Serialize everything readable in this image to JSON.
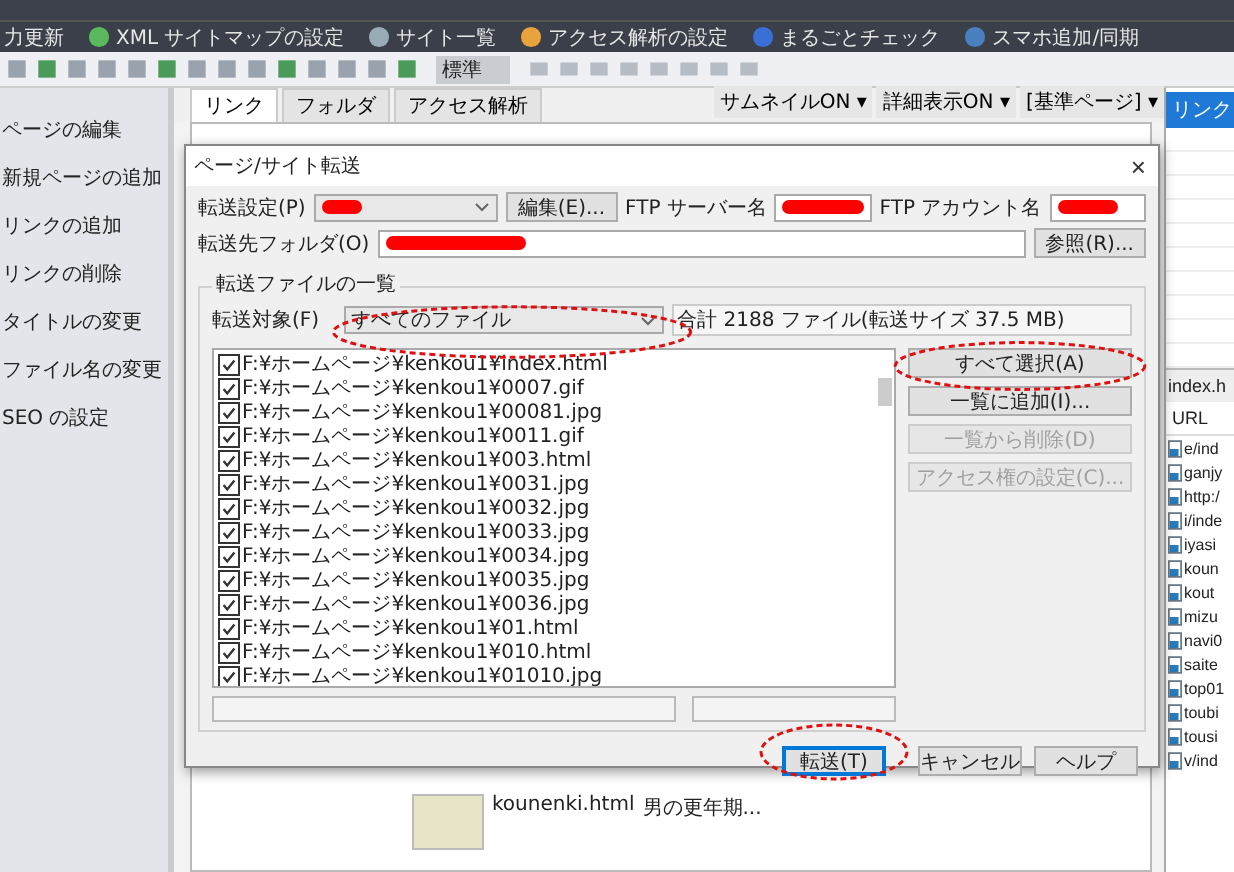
{
  "menu_bar": {
    "items": [
      {
        "label": "力更新"
      },
      {
        "label": "XML サイトマップの設定"
      },
      {
        "label": "サイト一覧"
      },
      {
        "label": "アクセス解析の設定"
      },
      {
        "label": "まるごとチェック"
      },
      {
        "label": "スマホ追加/同期"
      }
    ]
  },
  "toolbar": {
    "style_select": "標準"
  },
  "sidebar": {
    "items": [
      "ページの編集",
      "新規ページの追加",
      "リンクの追加",
      "リンクの削除",
      "タイトルの変更",
      "ファイル名の変更",
      "SEO の設定"
    ]
  },
  "center": {
    "tabs": [
      {
        "label": "リンク",
        "selected": true
      },
      {
        "label": "フォルダ",
        "selected": false
      },
      {
        "label": "アクセス解析",
        "selected": false
      }
    ],
    "view_options": [
      "サムネイルON ▾",
      "詳細表示ON ▾",
      "[基準ページ] ▾"
    ],
    "thumbnails": [
      {
        "file": "kounenki.html",
        "title": "男の更年期..."
      }
    ]
  },
  "right_panel": {
    "header": "リンク",
    "list_header": "index.h",
    "column": "URL",
    "urls": [
      "e/ind",
      "ganjy",
      "http:/",
      "i/inde",
      "iyasi",
      "koun",
      "kout",
      "mizu",
      "navi0",
      "saite",
      "top01",
      "toubi",
      "tousi",
      "v/ind"
    ]
  },
  "dialog": {
    "title": "ページ/サイト転送",
    "close": "×",
    "transfer_setting_label": "転送設定(P)",
    "edit_button": "編集(E)...",
    "ftp_server_label": "FTP サーバー名",
    "ftp_account_label": "FTP アカウント名",
    "dest_folder_label": "転送先フォルダ(O)",
    "browse_button": "参照(R)...",
    "group_title": "転送ファイルの一覧",
    "target_label": "転送対象(F)",
    "target_value": "すべてのファイル",
    "summary": "合計 2188 ファイル(転送サイズ 37.5 MB)",
    "files": [
      {
        "path": "F:¥ホームページ¥kenkou1¥index.html",
        "checked": true
      },
      {
        "path": "F:¥ホームページ¥kenkou1¥0007.gif",
        "checked": true
      },
      {
        "path": "F:¥ホームページ¥kenkou1¥00081.jpg",
        "checked": true
      },
      {
        "path": "F:¥ホームページ¥kenkou1¥0011.gif",
        "checked": true
      },
      {
        "path": "F:¥ホームページ¥kenkou1¥003.html",
        "checked": true
      },
      {
        "path": "F:¥ホームページ¥kenkou1¥0031.jpg",
        "checked": true
      },
      {
        "path": "F:¥ホームページ¥kenkou1¥0032.jpg",
        "checked": true
      },
      {
        "path": "F:¥ホームページ¥kenkou1¥0033.jpg",
        "checked": true
      },
      {
        "path": "F:¥ホームページ¥kenkou1¥0034.jpg",
        "checked": true
      },
      {
        "path": "F:¥ホームページ¥kenkou1¥0035.jpg",
        "checked": true
      },
      {
        "path": "F:¥ホームページ¥kenkou1¥0036.jpg",
        "checked": true
      },
      {
        "path": "F:¥ホームページ¥kenkou1¥01.html",
        "checked": true
      },
      {
        "path": "F:¥ホームページ¥kenkou1¥010.html",
        "checked": true
      },
      {
        "path": "F:¥ホームページ¥kenkou1¥01010.jpg",
        "checked": true
      }
    ],
    "progress": [
      {
        "level": 0
      },
      {
        "level": 0
      }
    ],
    "side_buttons": [
      {
        "label": "すべて選択(A)",
        "disabled": false
      },
      {
        "label": "一覧に追加(I)...",
        "disabled": false
      },
      {
        "label": "一覧から削除(D)",
        "disabled": true
      },
      {
        "label": "アクセス権の設定(C)...",
        "disabled": true
      }
    ],
    "buttons": [
      {
        "label": "転送(T)",
        "default": true
      },
      {
        "label": "キャンセル",
        "default": false
      },
      {
        "label": "ヘルプ",
        "default": false
      }
    ]
  }
}
